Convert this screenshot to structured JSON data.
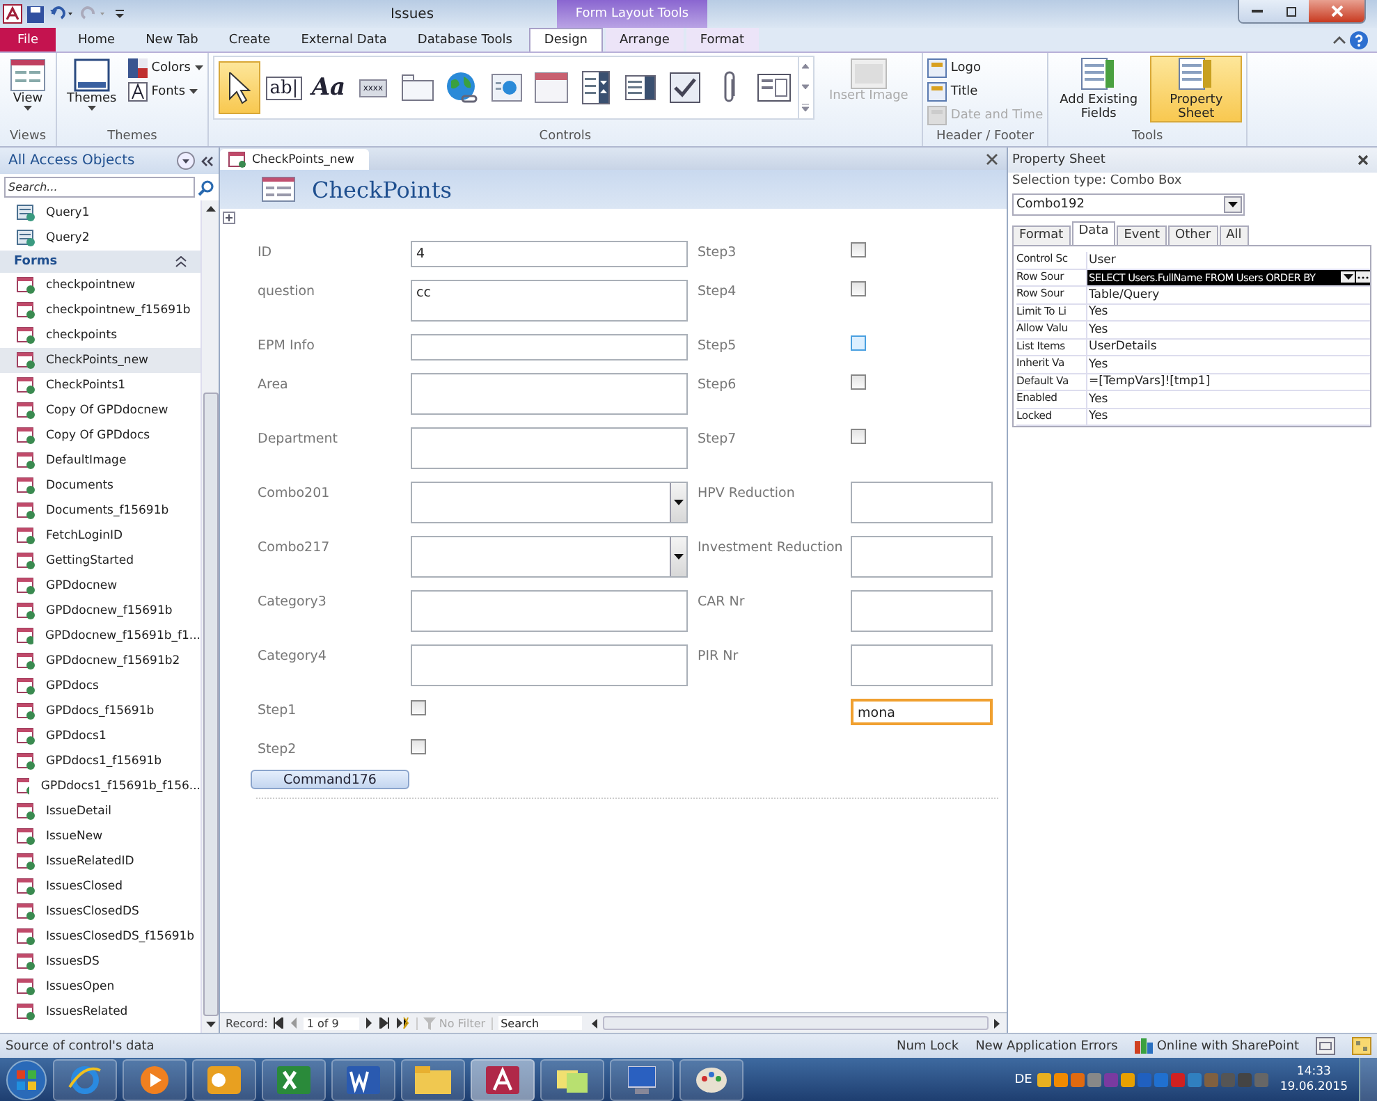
{
  "window": {
    "title": "Issues",
    "context_title": "Form Layout Tools"
  },
  "ribbon_tabs": [
    {
      "label": "File",
      "kind": "file",
      "selected": false
    },
    {
      "label": "Home",
      "kind": "tab",
      "selected": false
    },
    {
      "label": "New Tab",
      "kind": "tab",
      "selected": false
    },
    {
      "label": "Create",
      "kind": "tab",
      "selected": false
    },
    {
      "label": "External Data",
      "kind": "tab",
      "selected": false
    },
    {
      "label": "Database Tools",
      "kind": "tab",
      "selected": false
    },
    {
      "label": "Design",
      "kind": "context",
      "selected": true
    },
    {
      "label": "Arrange",
      "kind": "context",
      "selected": false
    },
    {
      "label": "Format",
      "kind": "context",
      "selected": false
    }
  ],
  "ribbon": {
    "views": {
      "label": "Views",
      "view_button": "View"
    },
    "themes": {
      "label": "Themes",
      "themes_button": "Themes",
      "colors_button": "Colors",
      "fonts_button": "Fonts"
    },
    "controls": {
      "label": "Controls",
      "items": [
        {
          "kind": "pointer",
          "selected": true
        },
        {
          "kind": "textbox",
          "glyph": "ab|",
          "selected": false
        },
        {
          "kind": "label",
          "glyph": "Aa",
          "selected": false
        },
        {
          "kind": "button",
          "glyph": "xxxx",
          "selected": false
        },
        {
          "kind": "tab",
          "selected": false
        },
        {
          "kind": "hyperlink",
          "selected": false
        },
        {
          "kind": "browser",
          "selected": false
        },
        {
          "kind": "navigation",
          "selected": false
        },
        {
          "kind": "combo",
          "selected": false
        },
        {
          "kind": "listbox",
          "selected": false
        },
        {
          "kind": "checkbox",
          "selected": false
        },
        {
          "kind": "attachment",
          "selected": false
        },
        {
          "kind": "subform",
          "selected": false
        }
      ],
      "insert_image": {
        "label": "Insert Image",
        "disabled": true
      }
    },
    "header_footer": {
      "label": "Header / Footer",
      "items": [
        {
          "label": "Logo",
          "disabled": false
        },
        {
          "label": "Title",
          "disabled": false
        },
        {
          "label": "Date and Time",
          "disabled": true
        }
      ]
    },
    "tools": {
      "label": "Tools",
      "items": [
        {
          "label": "Add Existing Fields",
          "selected": false
        },
        {
          "label": "Property Sheet",
          "selected": true
        }
      ]
    }
  },
  "nav": {
    "title": "All Access Objects",
    "search_placeholder": "Search...",
    "items": [
      {
        "kind": "query",
        "label": "Query1",
        "selected": false
      },
      {
        "kind": "query",
        "label": "Query2",
        "selected": false
      },
      {
        "kind": "header",
        "label": "Forms",
        "expanded": true
      },
      {
        "kind": "form",
        "label": "checkpointnew",
        "selected": false
      },
      {
        "kind": "form",
        "label": "checkpointnew_f15691b",
        "selected": false
      },
      {
        "kind": "form",
        "label": "checkpoints",
        "selected": false
      },
      {
        "kind": "form",
        "label": "CheckPoints_new",
        "selected": true
      },
      {
        "kind": "form",
        "label": "CheckPoints1",
        "selected": false
      },
      {
        "kind": "form",
        "label": "Copy Of GPDdocnew",
        "selected": false
      },
      {
        "kind": "form",
        "label": "Copy Of GPDdocs",
        "selected": false
      },
      {
        "kind": "form",
        "label": "DefaultImage",
        "selected": false
      },
      {
        "kind": "form",
        "label": "Documents",
        "selected": false
      },
      {
        "kind": "form",
        "label": "Documents_f15691b",
        "selected": false
      },
      {
        "kind": "form",
        "label": "FetchLoginID",
        "selected": false
      },
      {
        "kind": "form",
        "label": "GettingStarted",
        "selected": false
      },
      {
        "kind": "form",
        "label": "GPDdocnew",
        "selected": false
      },
      {
        "kind": "form",
        "label": "GPDdocnew_f15691b",
        "selected": false
      },
      {
        "kind": "form",
        "label": "GPDdocnew_f15691b_f1...",
        "selected": false
      },
      {
        "kind": "form",
        "label": "GPDdocnew_f15691b2",
        "selected": false
      },
      {
        "kind": "form",
        "label": "GPDdocs",
        "selected": false
      },
      {
        "kind": "form",
        "label": "GPDdocs_f15691b",
        "selected": false
      },
      {
        "kind": "form",
        "label": "GPDdocs1",
        "selected": false
      },
      {
        "kind": "form",
        "label": "GPDdocs1_f15691b",
        "selected": false
      },
      {
        "kind": "form",
        "label": "GPDdocs1_f15691b_f156...",
        "selected": false
      },
      {
        "kind": "form",
        "label": "IssueDetail",
        "selected": false
      },
      {
        "kind": "form",
        "label": "IssueNew",
        "selected": false
      },
      {
        "kind": "form",
        "label": "IssueRelatedID",
        "selected": false
      },
      {
        "kind": "form",
        "label": "IssuesClosed",
        "selected": false
      },
      {
        "kind": "form",
        "label": "IssuesClosedDS",
        "selected": false
      },
      {
        "kind": "form",
        "label": "IssuesClosedDS_f15691b",
        "selected": false
      },
      {
        "kind": "form",
        "label": "IssuesDS",
        "selected": false
      },
      {
        "kind": "form",
        "label": "IssuesOpen",
        "selected": false
      },
      {
        "kind": "form",
        "label": "IssuesRelated",
        "selected": false
      }
    ]
  },
  "document": {
    "tab": "CheckPoints_new",
    "header": "CheckPoints",
    "rows": [
      {
        "left": {
          "label": "ID",
          "kind": "text",
          "value": "4"
        },
        "right": {
          "label": "Step3",
          "kind": "checkbox",
          "checked": false,
          "focused": false
        }
      },
      {
        "left": {
          "label": "question",
          "kind": "textarea",
          "value": "cc"
        },
        "right": {
          "label": "Step4",
          "kind": "checkbox",
          "checked": false,
          "focused": false
        }
      },
      {
        "left": {
          "label": "EPM Info",
          "kind": "text"
        },
        "right": {
          "label": "Step5",
          "kind": "checkbox",
          "checked": false,
          "focused": true
        }
      },
      {
        "left": {
          "label": "Area",
          "kind": "textarea"
        },
        "right": {
          "label": "Step6",
          "kind": "checkbox",
          "checked": false,
          "focused": false
        }
      },
      {
        "left": {
          "label": "Department",
          "kind": "textarea"
        },
        "right": {
          "label": "Step7",
          "kind": "checkbox",
          "checked": false,
          "focused": false
        }
      },
      {
        "left": {
          "label": "Combo201",
          "kind": "combo"
        },
        "right": {
          "label": "HPV Reduction",
          "kind": "textarea",
          "selected": false
        }
      },
      {
        "left": {
          "label": "Combo217",
          "kind": "combo"
        },
        "right": {
          "label": "Investment Reduction",
          "kind": "textarea",
          "selected": false
        }
      },
      {
        "left": {
          "label": "Category3",
          "kind": "textarea"
        },
        "right": {
          "label": "CAR Nr",
          "kind": "textarea",
          "selected": false
        }
      },
      {
        "left": {
          "label": "Category4",
          "kind": "textarea"
        },
        "right": {
          "label": "PIR Nr",
          "kind": "textarea",
          "selected": false
        }
      },
      {
        "left": {
          "label": "Step1",
          "kind": "checkbox",
          "checked": false
        },
        "right": {
          "kind": "text",
          "value": "mona",
          "selected": true
        }
      },
      {
        "left": {
          "label": "Step2",
          "kind": "checkbox",
          "checked": false
        }
      }
    ],
    "command_button": "Command176",
    "record_nav": {
      "label": "Record:",
      "position": "1 of 9",
      "filter": "No Filter",
      "search": "Search"
    }
  },
  "property_sheet": {
    "title": "Property Sheet",
    "selection_type": "Selection type:  Combo Box",
    "object": "Combo192",
    "tabs": [
      {
        "label": "Format",
        "selected": false
      },
      {
        "label": "Data",
        "selected": true
      },
      {
        "label": "Event",
        "selected": false
      },
      {
        "label": "Other",
        "selected": false
      },
      {
        "label": "All",
        "selected": false
      }
    ],
    "rows": [
      {
        "name": "Control Sc",
        "value": "User",
        "selected": false
      },
      {
        "name": "Row Sour",
        "value": "SELECT Users.FullName FROM Users ORDER BY",
        "selected": true,
        "builder": true
      },
      {
        "name": "Row Sour",
        "value": "Table/Query",
        "selected": false
      },
      {
        "name": "Limit To Li",
        "value": "Yes",
        "selected": false
      },
      {
        "name": "Allow Valu",
        "value": "Yes",
        "selected": false
      },
      {
        "name": "List Items",
        "value": "UserDetails",
        "selected": false
      },
      {
        "name": "Inherit Va",
        "value": "Yes",
        "selected": false
      },
      {
        "name": "Default Va",
        "value": "=[TempVars]![tmp1]",
        "selected": false
      },
      {
        "name": "Enabled",
        "value": "Yes",
        "selected": false
      },
      {
        "name": "Locked",
        "value": "Yes",
        "selected": false
      }
    ]
  },
  "status_bar": {
    "message": "Source of control's data",
    "items": [
      "Num Lock",
      "New Application Errors"
    ],
    "sharepoint": "Online with SharePoint"
  },
  "taskbar": {
    "language": "DE",
    "time": "14:33",
    "date": "19.06.2015"
  }
}
